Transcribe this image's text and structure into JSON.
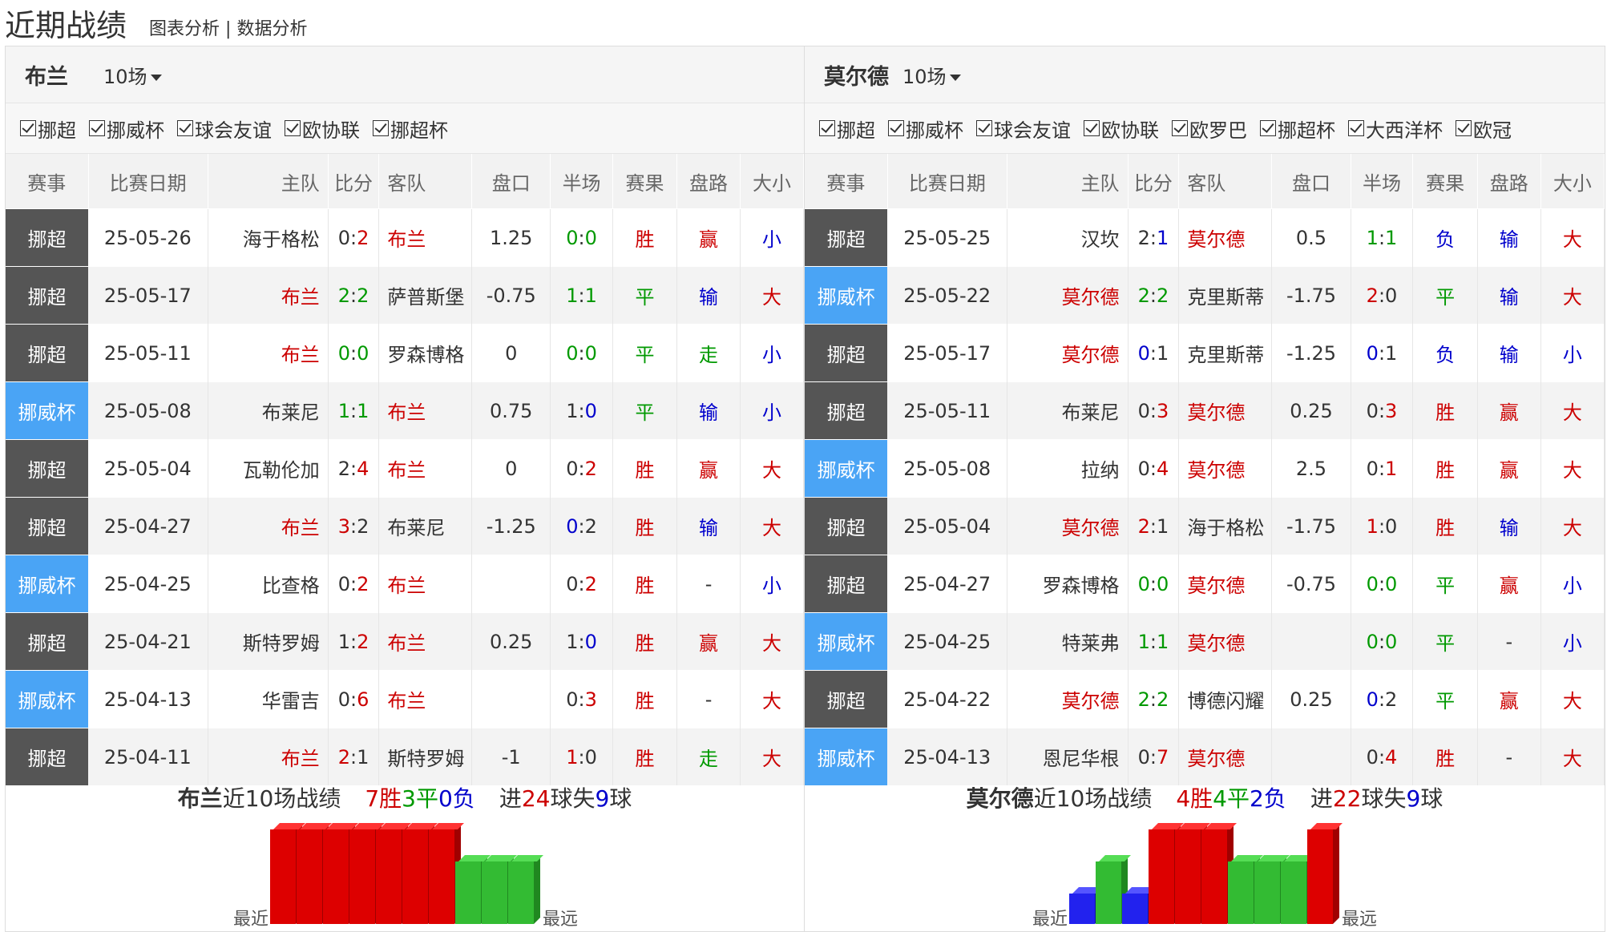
{
  "page": {
    "title": "近期战绩",
    "link1": "图表分析",
    "sep": "|",
    "link2": "数据分析"
  },
  "colors": {
    "win": "#dd0000",
    "draw": "#33bb33",
    "loss": "#2222ee",
    "league": "#555555",
    "cup": "#4aa4f5"
  },
  "headers": [
    "赛事",
    "比赛日期",
    "主队",
    "比分",
    "客队",
    "盘口",
    "半场",
    "赛果",
    "盘路",
    "大小"
  ],
  "left": {
    "team": "布兰",
    "count": "10场",
    "filters": [
      "挪超",
      "挪威杯",
      "球会友谊",
      "欧协联",
      "挪超杯"
    ],
    "rows": [
      {
        "lg": "挪超",
        "cup": false,
        "date": "25-05-26",
        "home": "海于格松",
        "hc": "dk",
        "s1": "0",
        "s2": "2",
        "sc1": "dk",
        "sc2": "rd",
        "away": "布兰",
        "ac": "rd",
        "hcp": "1.25",
        "h1": "0",
        "h2": "0",
        "hc1": "gr",
        "hc2": "gr",
        "res": "胜",
        "rc": "rd",
        "pl": "赢",
        "pc": "rd",
        "ou": "小",
        "oc": "bl"
      },
      {
        "lg": "挪超",
        "cup": false,
        "date": "25-05-17",
        "home": "布兰",
        "hc": "rd",
        "s1": "2",
        "s2": "2",
        "sc1": "gr",
        "sc2": "gr",
        "away": "萨普斯堡",
        "ac": "dk",
        "hcp": "-0.75",
        "h1": "1",
        "h2": "1",
        "hc1": "gr",
        "hc2": "gr",
        "res": "平",
        "rc": "gr",
        "pl": "输",
        "pc": "bl",
        "ou": "大",
        "oc": "rd"
      },
      {
        "lg": "挪超",
        "cup": false,
        "date": "25-05-11",
        "home": "布兰",
        "hc": "rd",
        "s1": "0",
        "s2": "0",
        "sc1": "gr",
        "sc2": "gr",
        "away": "罗森博格",
        "ac": "dk",
        "hcp": "0",
        "h1": "0",
        "h2": "0",
        "hc1": "gr",
        "hc2": "gr",
        "res": "平",
        "rc": "gr",
        "pl": "走",
        "pc": "gr",
        "ou": "小",
        "oc": "bl"
      },
      {
        "lg": "挪威杯",
        "cup": true,
        "date": "25-05-08",
        "home": "布莱尼",
        "hc": "dk",
        "s1": "1",
        "s2": "1",
        "sc1": "gr",
        "sc2": "gr",
        "away": "布兰",
        "ac": "rd",
        "hcp": "0.75",
        "h1": "1",
        "h2": "0",
        "hc1": "dk",
        "hc2": "bl",
        "res": "平",
        "rc": "gr",
        "pl": "输",
        "pc": "bl",
        "ou": "小",
        "oc": "bl"
      },
      {
        "lg": "挪超",
        "cup": false,
        "date": "25-05-04",
        "home": "瓦勒伦加",
        "hc": "dk",
        "s1": "2",
        "s2": "4",
        "sc1": "dk",
        "sc2": "rd",
        "away": "布兰",
        "ac": "rd",
        "hcp": "0",
        "h1": "0",
        "h2": "2",
        "hc1": "dk",
        "hc2": "rd",
        "res": "胜",
        "rc": "rd",
        "pl": "赢",
        "pc": "rd",
        "ou": "大",
        "oc": "rd"
      },
      {
        "lg": "挪超",
        "cup": false,
        "date": "25-04-27",
        "home": "布兰",
        "hc": "rd",
        "s1": "3",
        "s2": "2",
        "sc1": "rd",
        "sc2": "dk",
        "away": "布莱尼",
        "ac": "dk",
        "hcp": "-1.25",
        "h1": "0",
        "h2": "2",
        "hc1": "bl",
        "hc2": "dk",
        "res": "胜",
        "rc": "rd",
        "pl": "输",
        "pc": "bl",
        "ou": "大",
        "oc": "rd"
      },
      {
        "lg": "挪威杯",
        "cup": true,
        "date": "25-04-25",
        "home": "比查格",
        "hc": "dk",
        "s1": "0",
        "s2": "2",
        "sc1": "dk",
        "sc2": "rd",
        "away": "布兰",
        "ac": "rd",
        "hcp": "",
        "h1": "0",
        "h2": "2",
        "hc1": "dk",
        "hc2": "rd",
        "res": "胜",
        "rc": "rd",
        "pl": "-",
        "pc": "dk",
        "ou": "小",
        "oc": "bl"
      },
      {
        "lg": "挪超",
        "cup": false,
        "date": "25-04-21",
        "home": "斯特罗姆",
        "hc": "dk",
        "s1": "1",
        "s2": "2",
        "sc1": "dk",
        "sc2": "rd",
        "away": "布兰",
        "ac": "rd",
        "hcp": "0.25",
        "h1": "1",
        "h2": "0",
        "hc1": "dk",
        "hc2": "bl",
        "res": "胜",
        "rc": "rd",
        "pl": "赢",
        "pc": "rd",
        "ou": "大",
        "oc": "rd"
      },
      {
        "lg": "挪威杯",
        "cup": true,
        "date": "25-04-13",
        "home": "华雷吉",
        "hc": "dk",
        "s1": "0",
        "s2": "6",
        "sc1": "dk",
        "sc2": "rd",
        "away": "布兰",
        "ac": "rd",
        "hcp": "",
        "h1": "0",
        "h2": "3",
        "hc1": "dk",
        "hc2": "rd",
        "res": "胜",
        "rc": "rd",
        "pl": "-",
        "pc": "dk",
        "ou": "大",
        "oc": "rd"
      },
      {
        "lg": "挪超",
        "cup": false,
        "date": "25-04-11",
        "home": "布兰",
        "hc": "rd",
        "s1": "2",
        "s2": "1",
        "sc1": "rd",
        "sc2": "dk",
        "away": "斯特罗姆",
        "ac": "dk",
        "hcp": "-1",
        "h1": "1",
        "h2": "0",
        "hc1": "rd",
        "hc2": "dk",
        "res": "胜",
        "rc": "rd",
        "pl": "走",
        "pc": "gr",
        "ou": "大",
        "oc": "rd"
      }
    ],
    "summary": {
      "team": "布兰",
      "mid": "近10场战绩",
      "w": "7胜",
      "d": "3平",
      "l": "0负",
      "g1": "进",
      "gf": "24",
      "g2": "球失",
      "ga": "9",
      "g3": "球"
    },
    "bars_oldest_first": [
      "W",
      "W",
      "W",
      "W",
      "W",
      "W",
      "W",
      "D",
      "D",
      "D"
    ],
    "bars_label_left": "最近",
    "bars_label_right": "最远"
  },
  "right": {
    "team": "莫尔德",
    "count": "10场",
    "filters": [
      "挪超",
      "挪威杯",
      "球会友谊",
      "欧协联",
      "欧罗巴",
      "挪超杯",
      "大西洋杯",
      "欧冠"
    ],
    "rows": [
      {
        "lg": "挪超",
        "cup": false,
        "date": "25-05-25",
        "home": "汉坎",
        "hc": "dk",
        "s1": "2",
        "s2": "1",
        "sc1": "dk",
        "sc2": "bl",
        "away": "莫尔德",
        "ac": "rd",
        "hcp": "0.5",
        "h1": "1",
        "h2": "1",
        "hc1": "gr",
        "hc2": "gr",
        "res": "负",
        "rc": "bl",
        "pl": "输",
        "pc": "bl",
        "ou": "大",
        "oc": "rd"
      },
      {
        "lg": "挪威杯",
        "cup": true,
        "date": "25-05-22",
        "home": "莫尔德",
        "hc": "rd",
        "s1": "2",
        "s2": "2",
        "sc1": "gr",
        "sc2": "gr",
        "away": "克里斯蒂",
        "ac": "dk",
        "hcp": "-1.75",
        "h1": "2",
        "h2": "0",
        "hc1": "rd",
        "hc2": "dk",
        "res": "平",
        "rc": "gr",
        "pl": "输",
        "pc": "bl",
        "ou": "大",
        "oc": "rd"
      },
      {
        "lg": "挪超",
        "cup": false,
        "date": "25-05-17",
        "home": "莫尔德",
        "hc": "rd",
        "s1": "0",
        "s2": "1",
        "sc1": "bl",
        "sc2": "dk",
        "away": "克里斯蒂",
        "ac": "dk",
        "hcp": "-1.25",
        "h1": "0",
        "h2": "1",
        "hc1": "bl",
        "hc2": "dk",
        "res": "负",
        "rc": "bl",
        "pl": "输",
        "pc": "bl",
        "ou": "小",
        "oc": "bl"
      },
      {
        "lg": "挪超",
        "cup": false,
        "date": "25-05-11",
        "home": "布莱尼",
        "hc": "dk",
        "s1": "0",
        "s2": "3",
        "sc1": "dk",
        "sc2": "rd",
        "away": "莫尔德",
        "ac": "rd",
        "hcp": "0.25",
        "h1": "0",
        "h2": "3",
        "hc1": "dk",
        "hc2": "rd",
        "res": "胜",
        "rc": "rd",
        "pl": "赢",
        "pc": "rd",
        "ou": "大",
        "oc": "rd"
      },
      {
        "lg": "挪威杯",
        "cup": true,
        "date": "25-05-08",
        "home": "拉纳",
        "hc": "dk",
        "s1": "0",
        "s2": "4",
        "sc1": "dk",
        "sc2": "rd",
        "away": "莫尔德",
        "ac": "rd",
        "hcp": "2.5",
        "h1": "0",
        "h2": "1",
        "hc1": "dk",
        "hc2": "rd",
        "res": "胜",
        "rc": "rd",
        "pl": "赢",
        "pc": "rd",
        "ou": "大",
        "oc": "rd"
      },
      {
        "lg": "挪超",
        "cup": false,
        "date": "25-05-04",
        "home": "莫尔德",
        "hc": "rd",
        "s1": "2",
        "s2": "1",
        "sc1": "rd",
        "sc2": "dk",
        "away": "海于格松",
        "ac": "dk",
        "hcp": "-1.75",
        "h1": "1",
        "h2": "0",
        "hc1": "rd",
        "hc2": "dk",
        "res": "胜",
        "rc": "rd",
        "pl": "输",
        "pc": "bl",
        "ou": "大",
        "oc": "rd"
      },
      {
        "lg": "挪超",
        "cup": false,
        "date": "25-04-27",
        "home": "罗森博格",
        "hc": "dk",
        "s1": "0",
        "s2": "0",
        "sc1": "gr",
        "sc2": "gr",
        "away": "莫尔德",
        "ac": "rd",
        "hcp": "-0.75",
        "h1": "0",
        "h2": "0",
        "hc1": "gr",
        "hc2": "gr",
        "res": "平",
        "rc": "gr",
        "pl": "赢",
        "pc": "rd",
        "ou": "小",
        "oc": "bl"
      },
      {
        "lg": "挪威杯",
        "cup": true,
        "date": "25-04-25",
        "home": "特莱弗",
        "hc": "dk",
        "s1": "1",
        "s2": "1",
        "sc1": "gr",
        "sc2": "gr",
        "away": "莫尔德",
        "ac": "rd",
        "hcp": "",
        "h1": "0",
        "h2": "0",
        "hc1": "gr",
        "hc2": "gr",
        "res": "平",
        "rc": "gr",
        "pl": "-",
        "pc": "dk",
        "ou": "小",
        "oc": "bl"
      },
      {
        "lg": "挪超",
        "cup": false,
        "date": "25-04-22",
        "home": "莫尔德",
        "hc": "rd",
        "s1": "2",
        "s2": "2",
        "sc1": "gr",
        "sc2": "gr",
        "away": "博德闪耀",
        "ac": "dk",
        "hcp": "0.25",
        "h1": "0",
        "h2": "2",
        "hc1": "bl",
        "hc2": "dk",
        "res": "平",
        "rc": "gr",
        "pl": "赢",
        "pc": "rd",
        "ou": "大",
        "oc": "rd"
      },
      {
        "lg": "挪威杯",
        "cup": true,
        "date": "25-04-13",
        "home": "恩尼华根",
        "hc": "dk",
        "s1": "0",
        "s2": "7",
        "sc1": "dk",
        "sc2": "rd",
        "away": "莫尔德",
        "ac": "rd",
        "hcp": "",
        "h1": "0",
        "h2": "4",
        "hc1": "dk",
        "hc2": "rd",
        "res": "胜",
        "rc": "rd",
        "pl": "-",
        "pc": "dk",
        "ou": "大",
        "oc": "rd"
      }
    ],
    "summary": {
      "team": "莫尔德",
      "mid": "近10场战绩",
      "w": "4胜",
      "d": "4平",
      "l": "2负",
      "g1": "进",
      "gf": "22",
      "g2": "球失",
      "ga": "9",
      "g3": "球"
    },
    "bars_oldest_first": [
      "L",
      "D",
      "L",
      "W",
      "W",
      "W",
      "D",
      "D",
      "D",
      "W"
    ],
    "bars_label_left": "最近",
    "bars_label_right": "最远"
  }
}
